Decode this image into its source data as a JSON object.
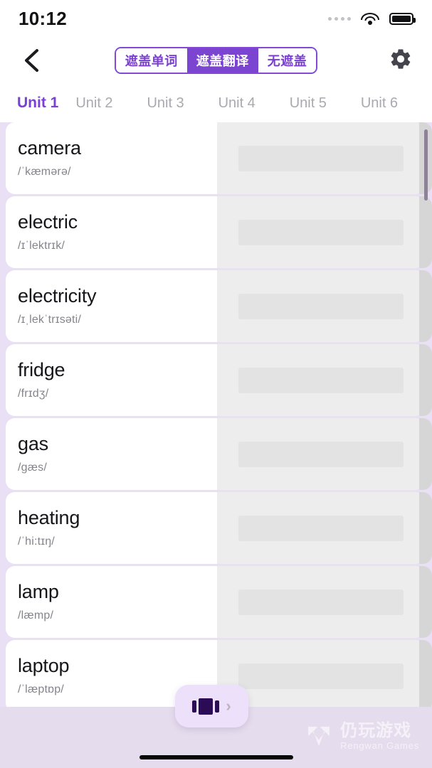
{
  "status_bar": {
    "time": "10:12",
    "signal_icon": "signal-dots-icon",
    "wifi_icon": "wifi-icon",
    "battery_icon": "battery-full-icon"
  },
  "top_bar": {
    "back_icon": "chevron-left-icon",
    "settings_icon": "gear-icon",
    "mask_modes": [
      {
        "label": "遮盖单词",
        "active": false
      },
      {
        "label": "遮盖翻译",
        "active": true
      },
      {
        "label": "无遮盖",
        "active": false
      }
    ]
  },
  "unit_tabs": [
    {
      "label": "Unit 1",
      "active": true
    },
    {
      "label": "Unit 2",
      "active": false
    },
    {
      "label": "Unit 3",
      "active": false
    },
    {
      "label": "Unit 4",
      "active": false
    },
    {
      "label": "Unit 5",
      "active": false
    },
    {
      "label": "Unit 6",
      "active": false
    }
  ],
  "word_list": [
    {
      "word": "camera",
      "phonetic": "/ˈkæmərə/"
    },
    {
      "word": "electric",
      "phonetic": "/ɪˈlektrɪk/"
    },
    {
      "word": "electricity",
      "phonetic": "/ɪˌlekˈtrɪsəti/"
    },
    {
      "word": "fridge",
      "phonetic": "/frɪdʒ/"
    },
    {
      "word": "gas",
      "phonetic": "/gæs/"
    },
    {
      "word": "heating",
      "phonetic": "/ˈhi:tɪŋ/"
    },
    {
      "word": "lamp",
      "phonetic": "/læmp/"
    },
    {
      "word": "laptop",
      "phonetic": "/ˈlæptɒp/"
    }
  ],
  "floating_button": {
    "cards_icon": "card-stack-icon",
    "chevron_icon": "chevron-right-icon",
    "chevron_glyph": "›"
  },
  "watermark": {
    "logo_icon": "rengwan-logo-icon",
    "cn_text": "仍玩游戏",
    "en_text": "Rengwan Games"
  },
  "colors": {
    "accent": "#7b3fd4",
    "accent_active": "#7b44d1",
    "list_background": "#e9e0f5",
    "card_background": "#ffffff",
    "mask_background": "#ededed",
    "bottom_background": "#e5dced"
  }
}
